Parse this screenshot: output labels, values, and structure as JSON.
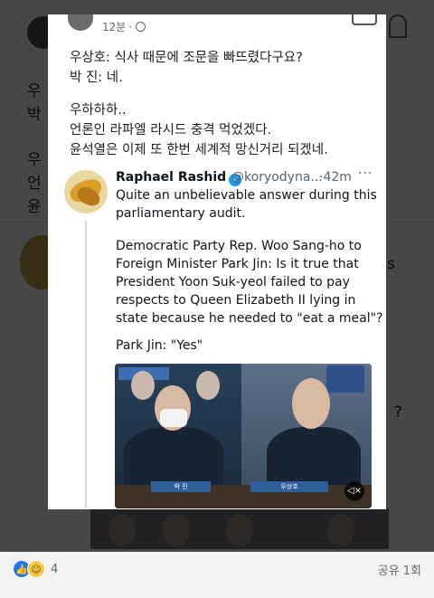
{
  "post": {
    "time": "12분",
    "lines": [
      "우상호: 식사 때문에 조문을 빠뜨렸다구요?",
      "박   진: 네.",
      "",
      "우하하하..",
      "언론인 라파엘 라시드 충격 먹었겠다.",
      "윤석열은 이제 또 한번 세계적 망신거리 되겠네."
    ]
  },
  "tweet": {
    "name": "Raphael Rashid",
    "handle": "@koryodyna...",
    "separator": "·",
    "time": "42m",
    "more": "···",
    "lines": [
      "Quite an unbelievable answer during this",
      "parliamentary audit.",
      "",
      "Democratic Party Rep. Woo Sang-ho to",
      "Foreign Minister Park Jin: Is it true that",
      "President Yoon Suk-yeol failed to pay",
      "respects to Queen Elizabeth II lying in",
      "state because he needed to \"eat a meal\"?",
      "",
      "Park Jin: \"Yes\""
    ],
    "video_captions": [
      "박 진",
      "우상호"
    ]
  },
  "background": {
    "fragments": [
      "우",
      "박",
      "우",
      "언",
      "윤",
      "s",
      "?"
    ]
  },
  "footer": {
    "reaction_count": "4",
    "share_text": "공유 1회"
  },
  "colors": {
    "overlay": "#000000",
    "verified": "#1d9bf0",
    "like": "#1877f2"
  },
  "icons": [
    "globe-icon",
    "more-icon",
    "verified-icon",
    "mute-icon",
    "like-icon",
    "haha-icon",
    "add-friend-icon"
  ]
}
